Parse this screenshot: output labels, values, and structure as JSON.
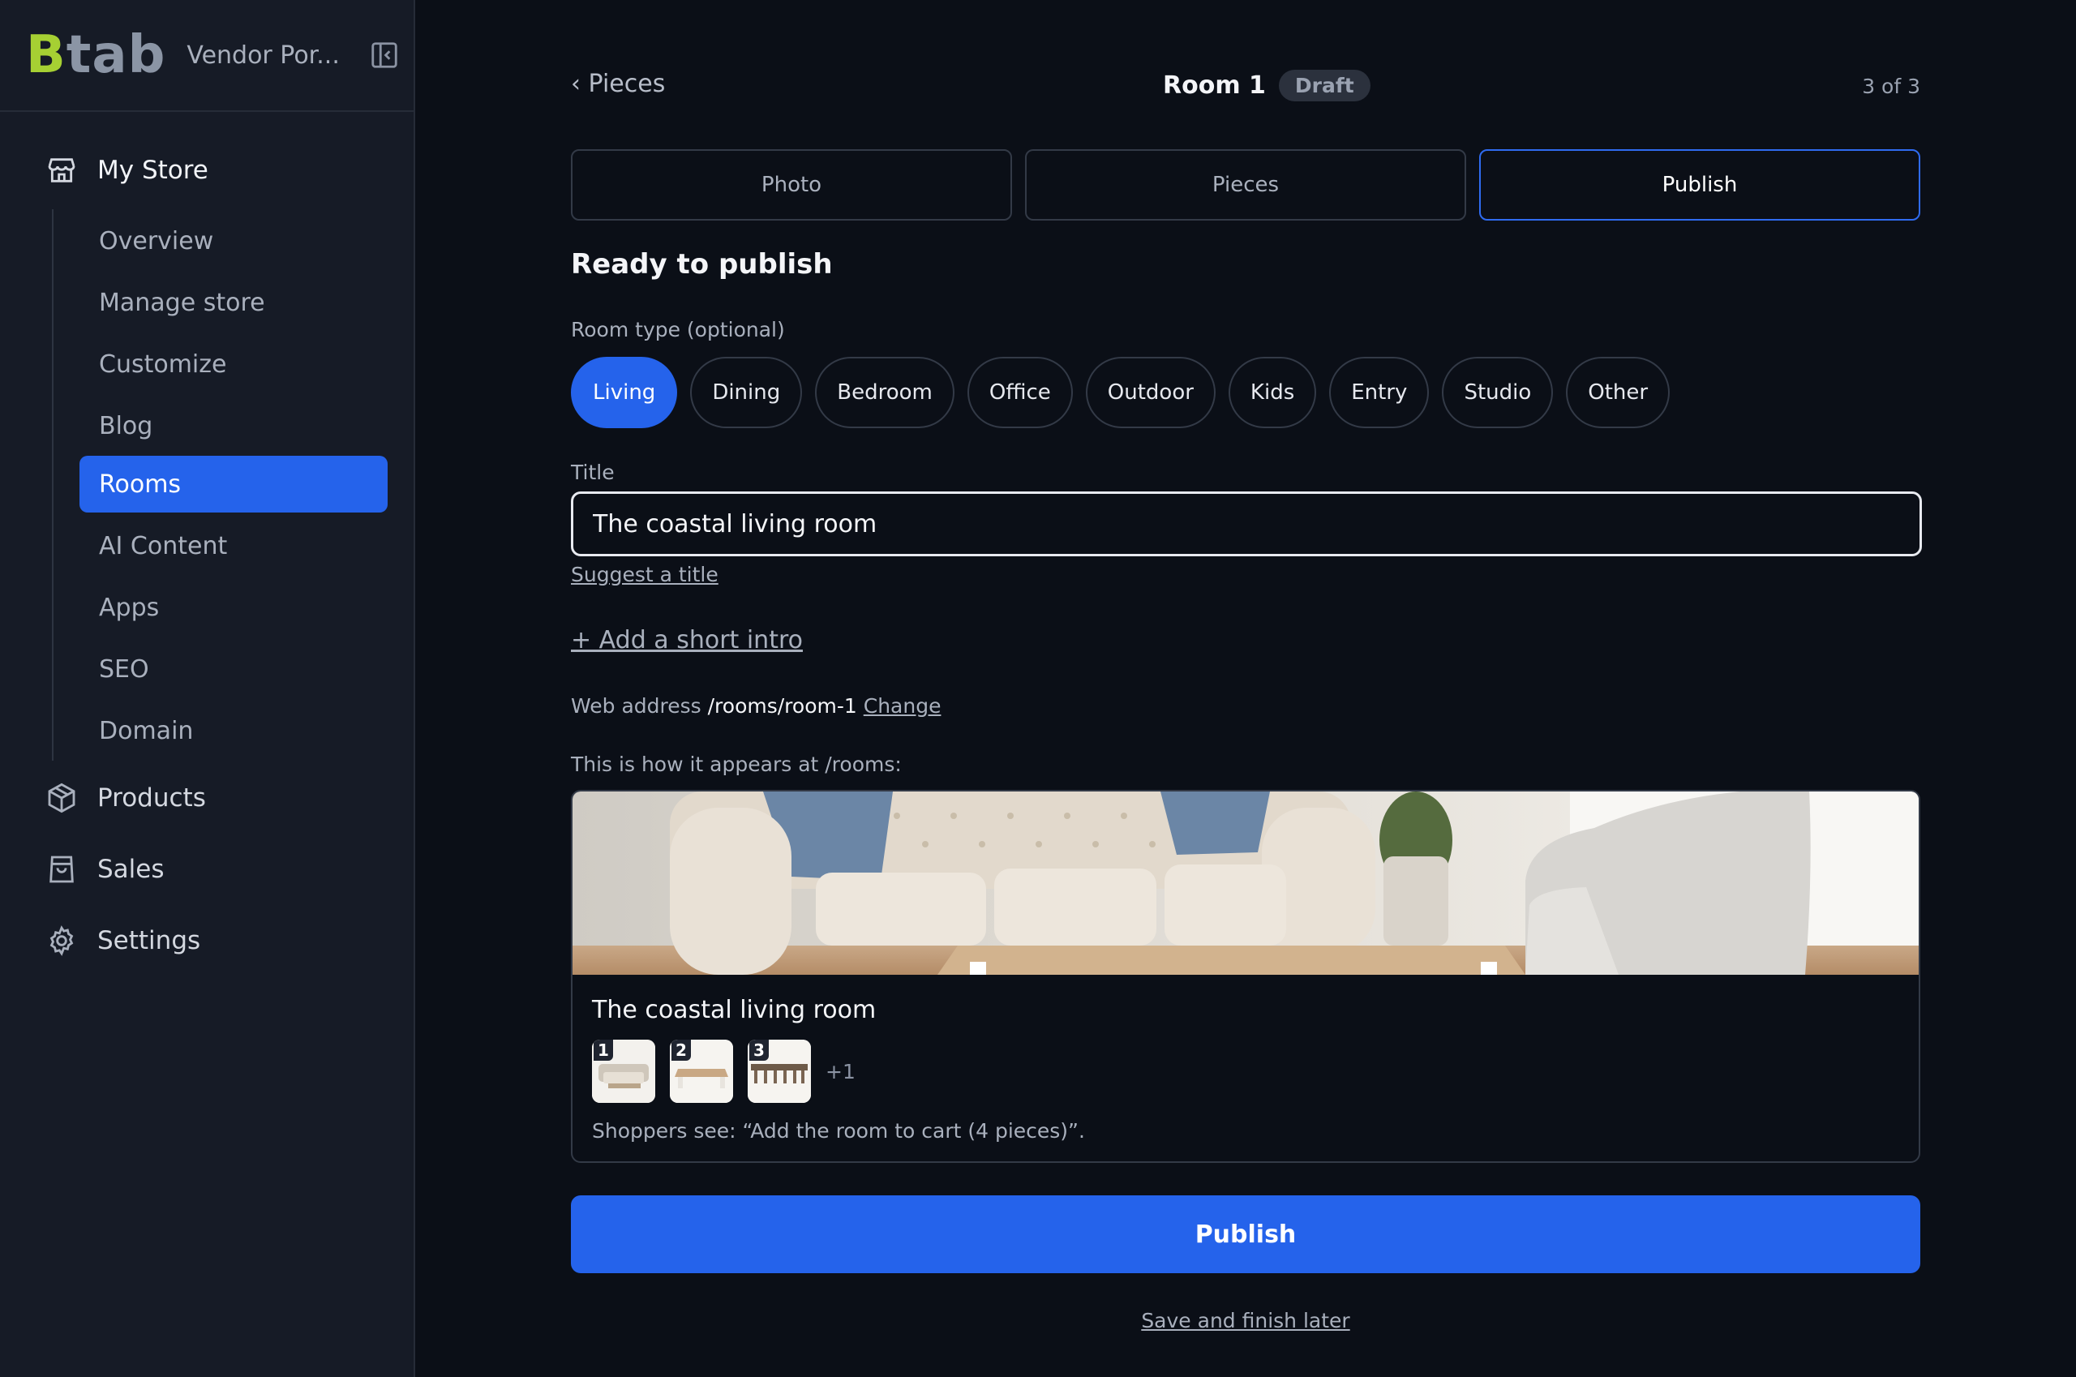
{
  "sidebar": {
    "logo": {
      "b": "B",
      "rest": "tab"
    },
    "vendor_name": "Vendor Por...",
    "my_store_label": "My Store",
    "store_items": [
      {
        "label": "Overview"
      },
      {
        "label": "Manage store"
      },
      {
        "label": "Customize"
      },
      {
        "label": "Blog"
      },
      {
        "label": "Rooms",
        "active": true
      },
      {
        "label": "AI Content"
      },
      {
        "label": "Apps"
      },
      {
        "label": "SEO"
      },
      {
        "label": "Domain"
      }
    ],
    "other_items": [
      {
        "label": "Products",
        "icon": "box-icon"
      },
      {
        "label": "Sales",
        "icon": "shopping-bag-icon"
      },
      {
        "label": "Settings",
        "icon": "gear-icon"
      }
    ]
  },
  "header": {
    "back_label": "‹ Pieces",
    "room_name": "Room 1",
    "status_badge": "Draft",
    "step_count": "3 of 3"
  },
  "tabs": [
    {
      "label": "Photo"
    },
    {
      "label": "Pieces"
    },
    {
      "label": "Publish",
      "active": true
    }
  ],
  "form": {
    "section_title": "Ready to publish",
    "room_type_label": "Room type (optional)",
    "room_types": [
      "Living",
      "Dining",
      "Bedroom",
      "Office",
      "Outdoor",
      "Kids",
      "Entry",
      "Studio",
      "Other"
    ],
    "selected_room_type": "Living",
    "title_label": "Title",
    "title_value": "The coastal living room",
    "suggest_title": "Suggest a title",
    "add_intro": "+ Add a short intro",
    "web_address_label": "Web address",
    "web_address_path": "/rooms/room-1",
    "web_address_change": "Change",
    "appears_text": "This is how it appears at /rooms:"
  },
  "preview": {
    "title": "The coastal living room",
    "thumbnails": [
      "1",
      "2",
      "3"
    ],
    "more_count": "+1",
    "shoppers_text": "Shoppers see: “Add the room to cart (4 pieces)”."
  },
  "actions": {
    "publish_label": "Publish",
    "save_later_label": "Save and finish later"
  },
  "colors": {
    "accent": "#2563eb",
    "logo_green": "#a6d033",
    "background": "#0b0f17",
    "sidebar_bg": "#161b26"
  }
}
